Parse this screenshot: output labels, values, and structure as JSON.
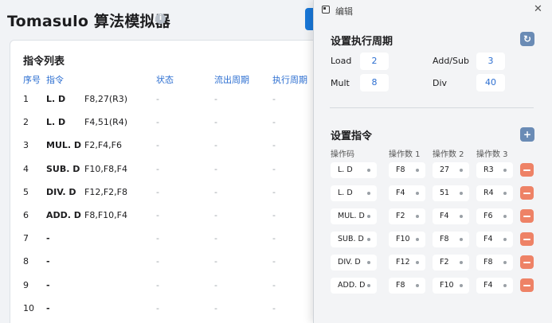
{
  "app": {
    "title": "Tomasulo 算法模拟器",
    "info_icon": "i"
  },
  "instruction_list": {
    "title": "指令列表",
    "columns": [
      "序号",
      "指令",
      "状态",
      "流出周期",
      "执行周期"
    ],
    "rows": [
      {
        "no": "1",
        "op": "L. D",
        "operands": "F8,27(R3)",
        "status": "-",
        "issue": "-",
        "exec": "-"
      },
      {
        "no": "2",
        "op": "L. D",
        "operands": "F4,51(R4)",
        "status": "-",
        "issue": "-",
        "exec": "-"
      },
      {
        "no": "3",
        "op": "MUL. D",
        "operands": "F2,F4,F6",
        "status": "-",
        "issue": "-",
        "exec": "-"
      },
      {
        "no": "4",
        "op": "SUB. D",
        "operands": "F10,F8,F4",
        "status": "-",
        "issue": "-",
        "exec": "-"
      },
      {
        "no": "5",
        "op": "DIV. D",
        "operands": "F12,F2,F8",
        "status": "-",
        "issue": "-",
        "exec": "-"
      },
      {
        "no": "6",
        "op": "ADD. D",
        "operands": "F8,F10,F4",
        "status": "-",
        "issue": "-",
        "exec": "-"
      },
      {
        "no": "7",
        "op": "-",
        "operands": "",
        "status": "-",
        "issue": "-",
        "exec": "-"
      },
      {
        "no": "8",
        "op": "-",
        "operands": "",
        "status": "-",
        "issue": "-",
        "exec": "-"
      },
      {
        "no": "9",
        "op": "-",
        "operands": "",
        "status": "-",
        "issue": "-",
        "exec": "-"
      },
      {
        "no": "10",
        "op": "-",
        "operands": "",
        "status": "-",
        "issue": "-",
        "exec": "-"
      }
    ]
  },
  "dialog": {
    "title": "编辑",
    "close_icon": "✕",
    "cycles": {
      "title": "设置执行周期",
      "refresh_icon": "↻",
      "items": [
        {
          "label": "Load",
          "value": "2"
        },
        {
          "label": "Add/Sub",
          "value": "3"
        },
        {
          "label": "Mult",
          "value": "8"
        },
        {
          "label": "Div",
          "value": "40"
        }
      ]
    },
    "instructions": {
      "title": "设置指令",
      "add_icon": "+",
      "columns": [
        "操作码",
        "操作数 1",
        "操作数 2",
        "操作数 3"
      ],
      "rows": [
        {
          "opcode": "L. D",
          "op1": "F8",
          "op2": "27",
          "op3": "R3"
        },
        {
          "opcode": "L. D",
          "op1": "F4",
          "op2": "51",
          "op3": "R4"
        },
        {
          "opcode": "MUL. D",
          "op1": "F2",
          "op2": "F4",
          "op3": "F6"
        },
        {
          "opcode": "SUB. D",
          "op1": "F10",
          "op2": "F8",
          "op3": "F4"
        },
        {
          "opcode": "DIV. D",
          "op1": "F12",
          "op2": "F2",
          "op3": "F8"
        },
        {
          "opcode": "ADD. D",
          "op1": "F8",
          "op2": "F10",
          "op3": "F4"
        }
      ]
    }
  },
  "colors": {
    "accent": "#1877d8",
    "header_text": "#2d6fd1",
    "delete": "#ee8266",
    "icon_button": "#6a8bb5"
  }
}
